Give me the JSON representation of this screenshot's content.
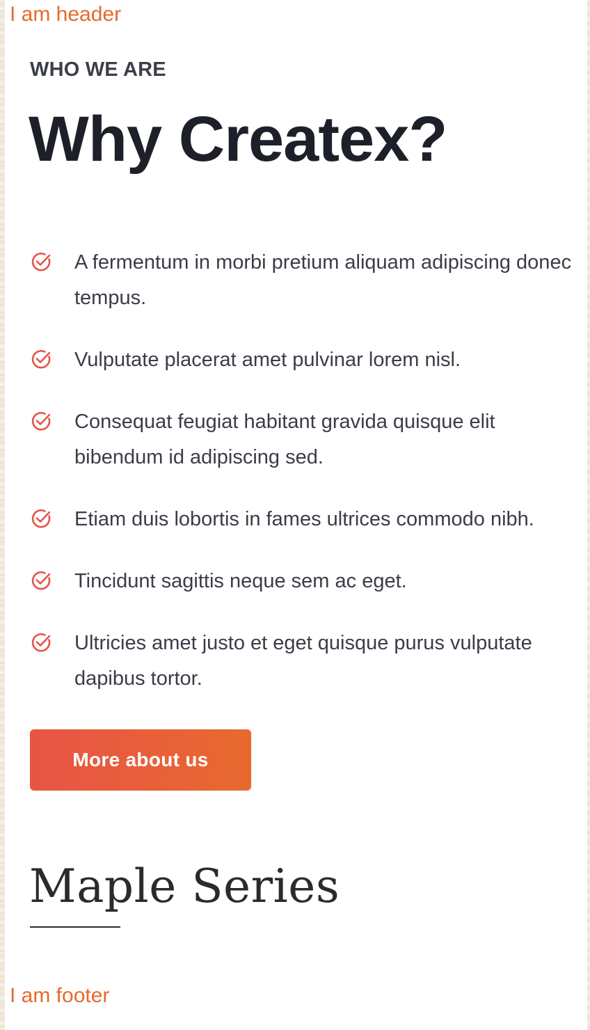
{
  "header": {
    "text": "I am header"
  },
  "section": {
    "eyebrow": "WHO WE ARE",
    "title": "Why Createx?",
    "features": [
      "A fermentum in morbi pretium aliquam adipiscing donec tempus.",
      "Vulputate placerat amet pulvinar lorem nisl.",
      "Consequat feugiat habitant gravida quisque elit bibendum id adipiscing sed.",
      "Etiam duis lobortis in fames ultrices commodo nibh.",
      "Tincidunt sagittis neque sem ac eget.",
      "Ultricies amet justo et eget quisque purus vulputate dapibus tortor."
    ],
    "feature_icon": "check-circle-icon",
    "cta_label": "More about us"
  },
  "series": {
    "title": "Maple Series"
  },
  "footer": {
    "text": "I am footer"
  },
  "colors": {
    "accent": "#e66a2c",
    "check": "#e5544a",
    "cta_gradient_start": "#e85446",
    "cta_gradient_end": "#e8692f",
    "heading": "#1e2029",
    "body_text": "#3a3d48"
  }
}
